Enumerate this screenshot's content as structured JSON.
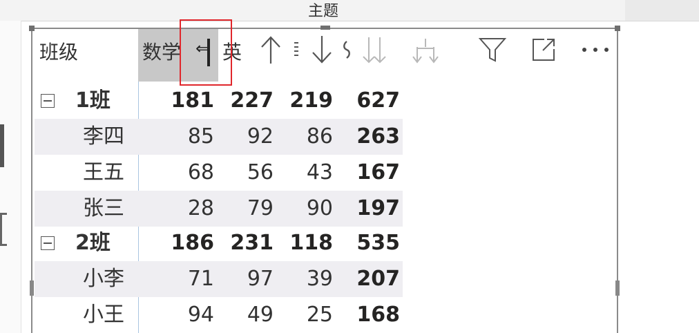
{
  "window": {
    "title": "主题"
  },
  "table": {
    "headers": {
      "class": "班级",
      "math": "数学",
      "english_partial": "英"
    },
    "groups": [
      {
        "name": "1班",
        "totals": [
          "181",
          "227",
          "219",
          "627"
        ],
        "rows": [
          {
            "name": "李四",
            "values": [
              "85",
              "92",
              "86",
              "263"
            ]
          },
          {
            "name": "王五",
            "values": [
              "68",
              "56",
              "43",
              "167"
            ]
          },
          {
            "name": "张三",
            "values": [
              "28",
              "79",
              "90",
              "197"
            ]
          }
        ]
      },
      {
        "name": "2班",
        "totals": [
          "186",
          "231",
          "118",
          "535"
        ],
        "rows": [
          {
            "name": "小李",
            "values": [
              "71",
              "97",
              "39",
              "207"
            ]
          },
          {
            "name": "小王",
            "values": [
              "94",
              "49",
              "25",
              "168"
            ]
          }
        ]
      }
    ]
  },
  "toolbar": {
    "icons": [
      "sort-ascending-icon",
      "sort-descending-icon",
      "drill-down-all-icon",
      "expand-hierarchy-icon",
      "filter-icon",
      "focus-mode-icon",
      "more-options-icon"
    ]
  },
  "colors": {
    "highlight": "#e0262b",
    "selected_header": "#c8c8c8",
    "row_alt": "#efeef2"
  }
}
